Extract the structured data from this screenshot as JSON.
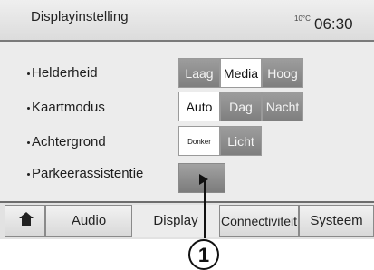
{
  "header": {
    "title": "Displayinstelling",
    "temperature": "10°C",
    "time": "06:30"
  },
  "settings": [
    {
      "label": "Helderheid",
      "options": [
        "Laag",
        "Media",
        "Hoog"
      ],
      "selected": "Media"
    },
    {
      "label": "Kaartmodus",
      "options": [
        "Auto",
        "Dag",
        "Nacht"
      ],
      "selected": "Auto"
    },
    {
      "label": "Achtergrond",
      "options": [
        "Donker",
        "Licht"
      ],
      "selected": "Donker"
    },
    {
      "label": "Parkeerassistentie",
      "button_icon": "play-icon"
    }
  ],
  "tabs": [
    {
      "icon": "home-icon"
    },
    {
      "label": "Audio"
    },
    {
      "label": "Display",
      "active": true
    },
    {
      "label": "Connectiviteit"
    },
    {
      "label": "Systeem"
    }
  ],
  "callout": {
    "label": "1"
  }
}
